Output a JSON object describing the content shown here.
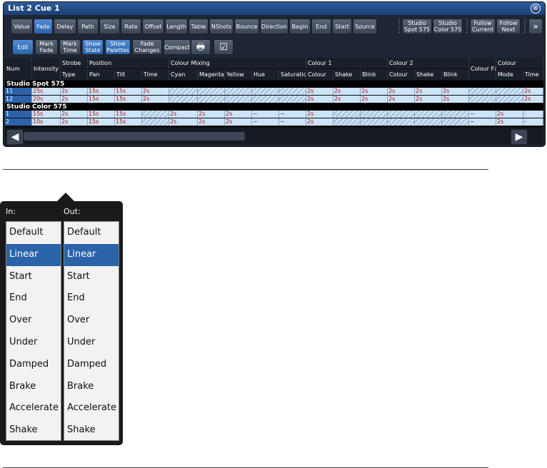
{
  "window": {
    "title": "List 2 Cue 1",
    "close": "⊗"
  },
  "toolbar1": [
    {
      "label": "Value",
      "active": false
    },
    {
      "label": "Fade",
      "active": true
    },
    {
      "label": "Delay",
      "active": false
    },
    {
      "label": "Path",
      "active": false
    },
    {
      "label": "Size",
      "active": false
    },
    {
      "label": "Rate",
      "active": false
    },
    {
      "label": "Offset",
      "active": false
    },
    {
      "label": "Length",
      "active": false
    },
    {
      "label": "Table",
      "active": false
    },
    {
      "label": "NShots",
      "active": false
    },
    {
      "label": "Bounce",
      "active": false
    },
    {
      "label": "Direction",
      "active": false
    },
    {
      "label": "Begin",
      "active": false
    },
    {
      "label": "End",
      "active": false
    },
    {
      "label": "Start",
      "active": false
    },
    {
      "label": "Source",
      "active": false
    }
  ],
  "toolbar1_extra": {
    "studio_spot": "Studio\nSpot 575",
    "studio_color": "Studio\nColor 575",
    "follow_current": "Follow\nCurrent",
    "follow_next": "Follow\nNext",
    "more": "»"
  },
  "toolbar2": [
    {
      "label": "Edit",
      "active": true
    },
    {
      "label": "Mark\nFade",
      "active": false
    },
    {
      "label": "Mark\nTime",
      "active": false
    },
    {
      "label": "Show\nState",
      "active": true
    },
    {
      "label": "Show\nPalettes",
      "active": true
    },
    {
      "label": "Fade\nChanges",
      "active": false
    },
    {
      "label": "Compact",
      "active": false
    }
  ],
  "sheet": {
    "group_headers": {
      "strobe": "Strobe",
      "position": "Position",
      "colour_mixing": "Colour Mixing",
      "colour1": "Colour 1",
      "colour2": "Colour 2",
      "colour_fx": "Colour Fx",
      "colour": "Colour"
    },
    "columns": [
      "Num",
      "Intensity",
      "Type",
      "Pan",
      "Tilt",
      "Time",
      "Cyan",
      "Magenta",
      "Yellow",
      "Hue",
      "Saturation",
      "Colour",
      "Shake",
      "Blink",
      "Colour",
      "Shake",
      "Blink",
      "",
      "Mode",
      "Time"
    ],
    "sections": [
      {
        "name": "Studio Spot 575",
        "rows": [
          {
            "num": "11",
            "cells": [
              "25s",
              "2s",
              "15s",
              "15s",
              "2s",
              "#",
              "#",
              "#",
              "#",
              "#",
              "2s",
              "2s",
              "2s",
              "2s",
              "2s",
              "2s",
              "#",
              "#",
              "2s"
            ]
          },
          {
            "num": "12",
            "cells": [
              "20s",
              "2s",
              "15s",
              "15s",
              "2s",
              "#",
              "#",
              "#",
              "#",
              "#",
              "2s",
              "2s",
              "2s",
              "2s",
              "2s",
              "2s",
              "#",
              "#",
              "2s"
            ]
          }
        ]
      },
      {
        "name": "Studio Color 575",
        "rows": [
          {
            "num": "1",
            "cells": [
              "15s",
              "2s",
              "15s",
              "15s",
              "#",
              "2s",
              "2s",
              "2s",
              "~",
              "~",
              "2s",
              "#",
              "#",
              "#",
              "#",
              "#",
              "~",
              "2s",
              "-"
            ]
          },
          {
            "num": "2",
            "cells": [
              "10s",
              "2s",
              "15s",
              "15s",
              "#",
              "2s",
              "2s",
              "2s",
              "~",
              "~",
              "2s",
              "#",
              "#",
              "#",
              "#",
              "#",
              "~",
              "2s",
              "-"
            ]
          }
        ]
      }
    ]
  },
  "popup": {
    "in_label": "In:",
    "out_label": "Out:",
    "options": [
      "Default",
      "Linear",
      "Start",
      "End",
      "Over",
      "Under",
      "Damped",
      "Brake",
      "Accelerate",
      "Shake"
    ],
    "selected_index": 1
  }
}
